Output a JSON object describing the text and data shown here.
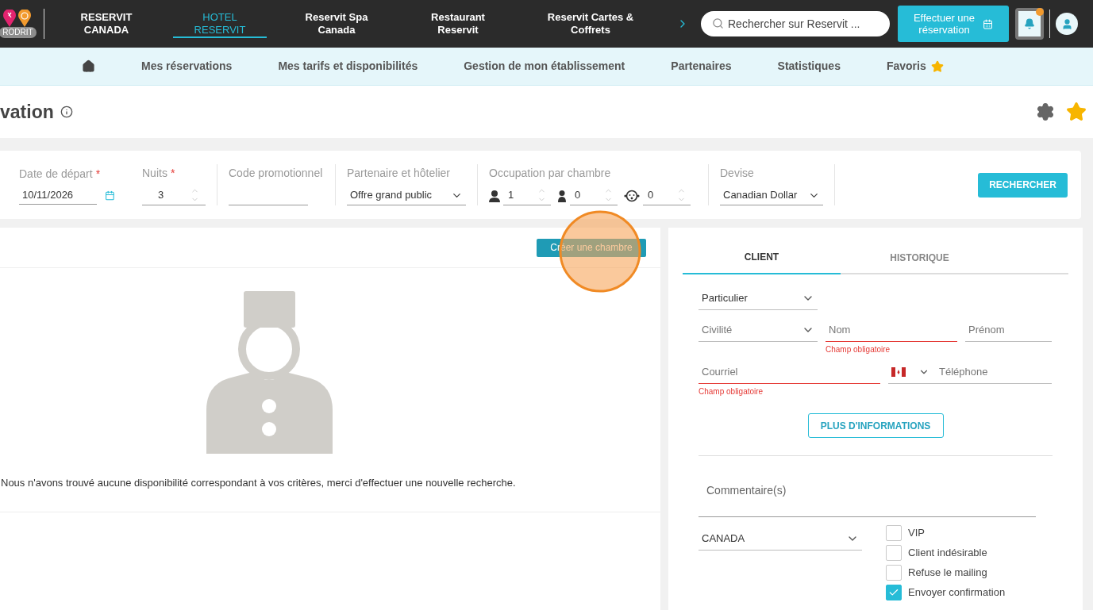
{
  "brand": {
    "badge": "RODRIT"
  },
  "top_nav": [
    {
      "label": "RESERVIT\nCANADA",
      "selected": false
    },
    {
      "label": "HOTEL\nRESERVIT",
      "selected": true
    },
    {
      "label": "Reservit Spa\nCanada",
      "selected": false
    },
    {
      "label": "Restaurant\nReservit",
      "selected": false
    },
    {
      "label": "Reservit Cartes &\nCoffrets",
      "selected": false
    }
  ],
  "search": {
    "placeholder": "Rechercher sur Reservit ..."
  },
  "book_button": "Effectuer une\nréservation",
  "notifications": {
    "unread": true
  },
  "sub_nav": [
    {
      "kind": "home"
    },
    {
      "kind": "link",
      "label": "Mes réservations"
    },
    {
      "kind": "link",
      "label": "Mes tarifs et disponibilités"
    },
    {
      "kind": "link",
      "label": "Gestion de mon établissement"
    },
    {
      "kind": "link",
      "label": "Partenaires"
    },
    {
      "kind": "link",
      "label": "Statistiques"
    },
    {
      "kind": "favorites",
      "label": "Favoris"
    }
  ],
  "page": {
    "title": "vation",
    "favorite": true
  },
  "search_form": {
    "departure": {
      "label": "Date de départ",
      "required_mark": "*",
      "value": "10/11/2026"
    },
    "nights": {
      "label": "Nuits",
      "required_mark": "*",
      "value": "3"
    },
    "promo": {
      "label": "Code promotionnel"
    },
    "partner": {
      "label": "Partenaire et hôtelier",
      "value": "Offre grand public"
    },
    "occupancy": {
      "label": "Occupation par chambre",
      "guests": [
        {
          "kind": "adult",
          "value": "1"
        },
        {
          "kind": "child",
          "value": "0"
        },
        {
          "kind": "baby",
          "value": "0"
        }
      ]
    },
    "currency": {
      "label": "Devise",
      "value": "Canadian Dollar"
    },
    "submit": "RECHERCHER"
  },
  "results": {
    "create_button": "Créer une chambre",
    "empty_message": "Nous n'avons trouvé aucune disponibilité correspondant à vos critères, merci d'effectuer une nouvelle recherche."
  },
  "client_tabs": [
    {
      "label": "CLIENT",
      "selected": true
    },
    {
      "label": "HISTORIQUE",
      "selected": false
    }
  ],
  "client_form": {
    "type": "Particulier",
    "civility": {
      "placeholder": "Civilité"
    },
    "last_name": {
      "placeholder": "Nom",
      "error": "Champ obligatoire"
    },
    "first_name": {
      "placeholder": "Prénom"
    },
    "email": {
      "placeholder": "Courriel",
      "error": "Champ obligatoire"
    },
    "phone": {
      "placeholder": "Téléphone"
    },
    "more_button": "PLUS D'INFORMATIONS",
    "comment": {
      "placeholder": "Commentaire(s)"
    },
    "country": "CANADA",
    "options": [
      {
        "label": "VIP",
        "checked": false
      },
      {
        "label": "Client indésirable",
        "checked": false
      },
      {
        "label": "Refuse le mailing",
        "checked": false
      },
      {
        "label": "Envoyer confirmation",
        "checked": true
      }
    ]
  }
}
